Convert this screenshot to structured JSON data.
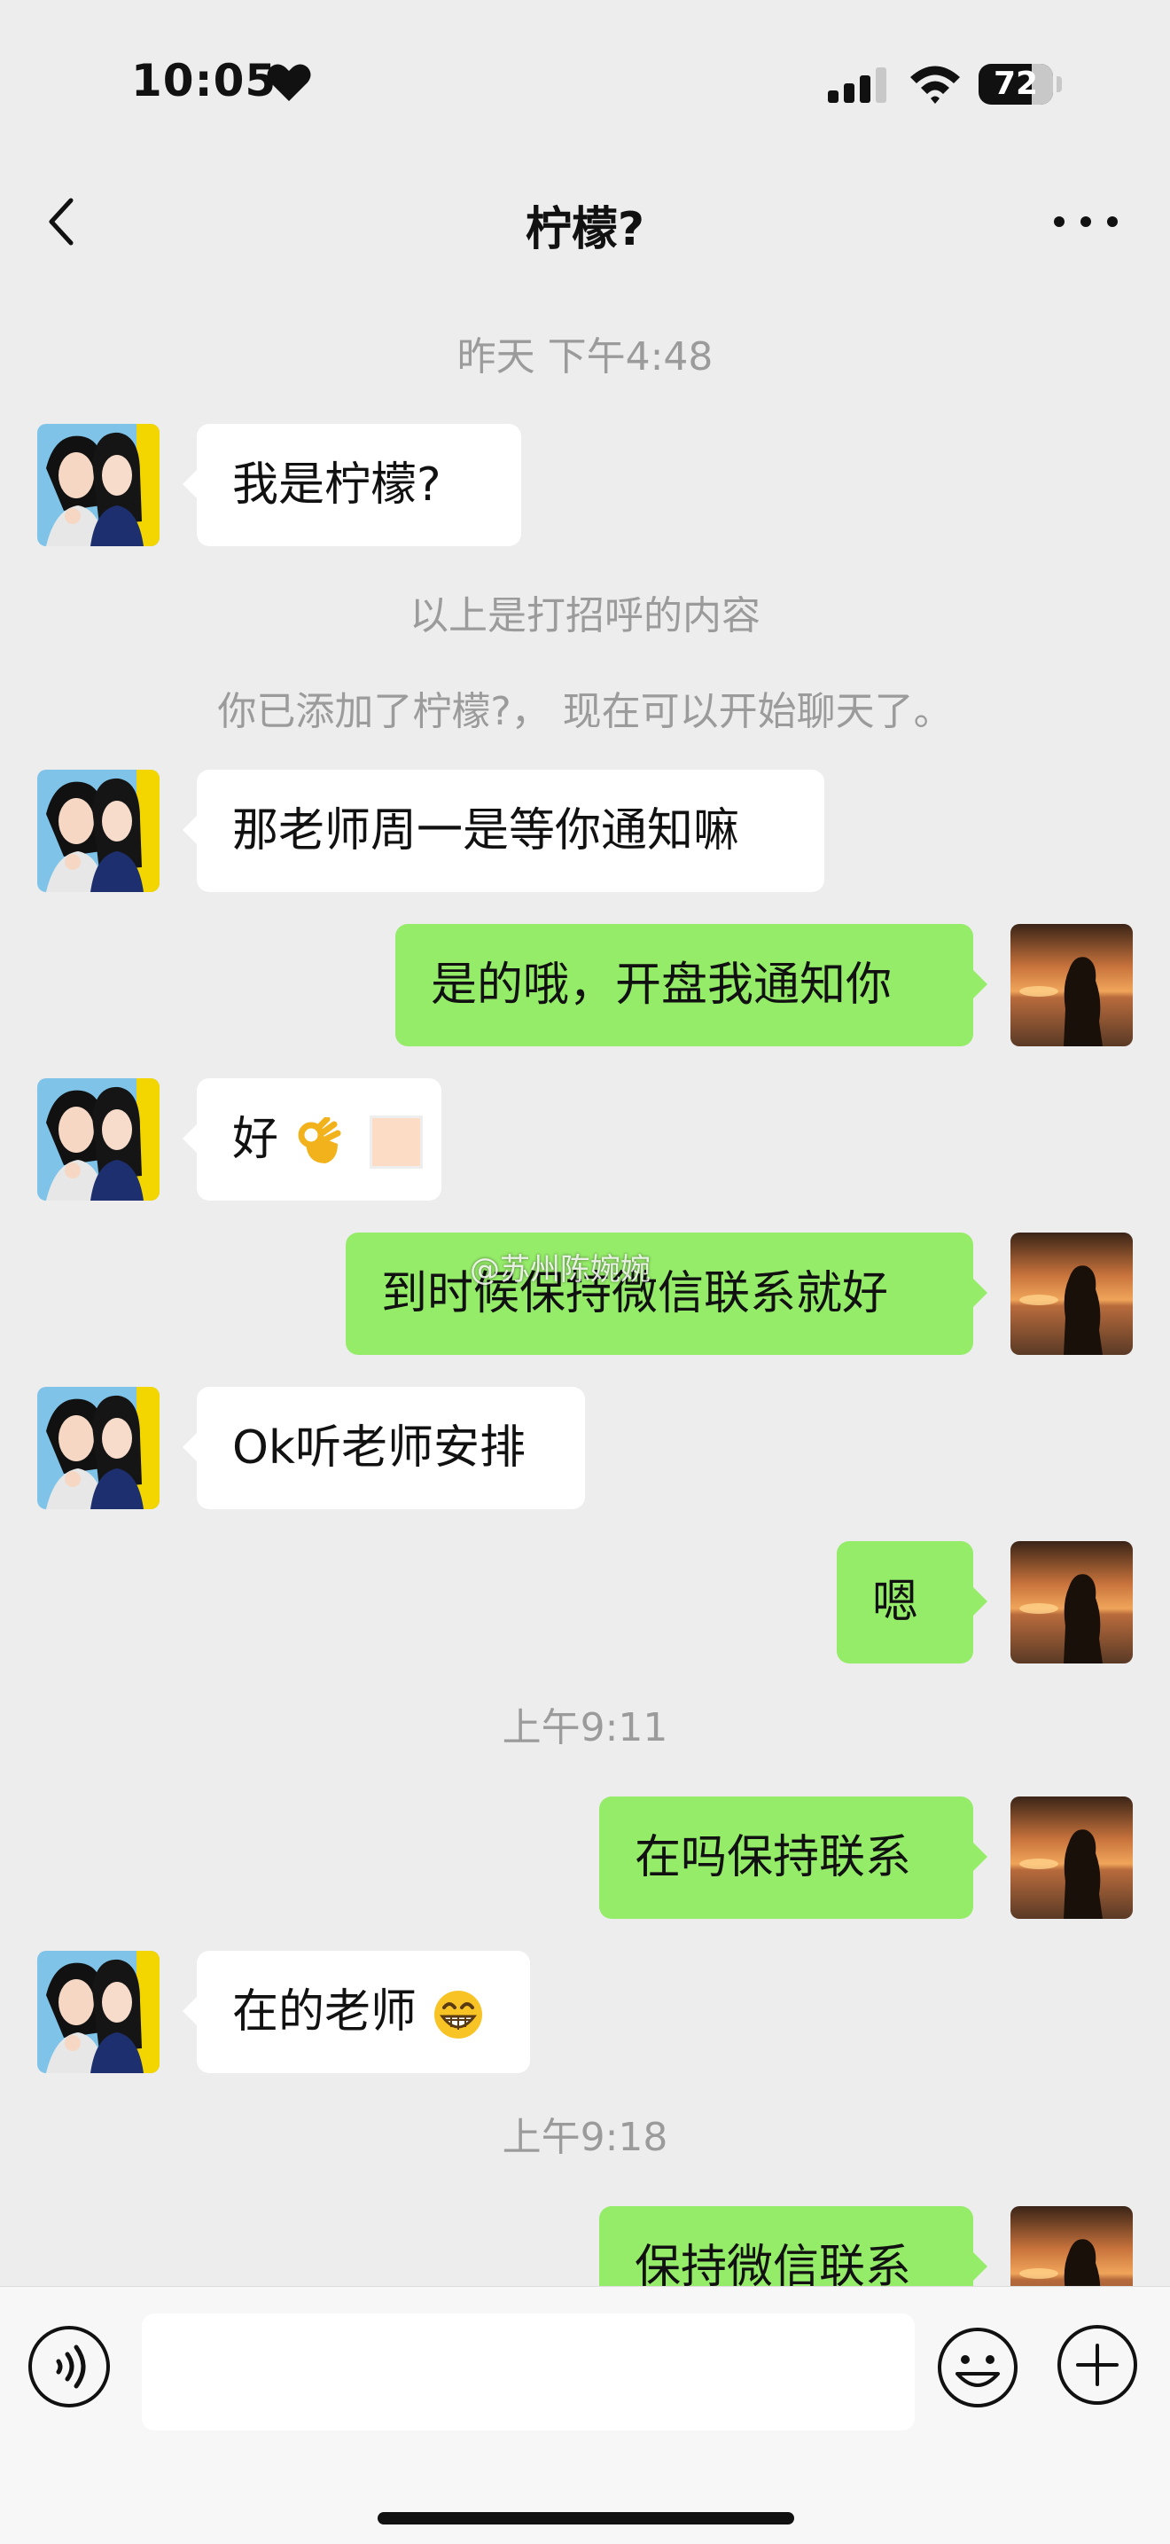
{
  "status_bar": {
    "time": "10:05",
    "battery": "72",
    "battery_level": 0.72
  },
  "nav": {
    "title": "柠檬?"
  },
  "timestamps": {
    "t1": "昨天 下午4:48",
    "t2": "上午9:11",
    "t3": "上午9:18"
  },
  "system_notes": {
    "greeting": "以上是打招呼的内容",
    "added": "你已添加了柠檬?， 现在可以开始聊天了。"
  },
  "messages": [
    {
      "from": "contact",
      "text": "我是柠檬?"
    },
    {
      "from": "contact",
      "text": "那老师周一是等你通知嘛"
    },
    {
      "from": "me",
      "text": "是的哦，开盘我通知你"
    },
    {
      "from": "contact",
      "text": "好"
    },
    {
      "from": "me",
      "text": "到时候保持微信联系就好"
    },
    {
      "from": "contact",
      "text": "Ok听老师安排"
    },
    {
      "from": "me",
      "text": "嗯"
    },
    {
      "from": "me",
      "text": "在吗保持联系"
    },
    {
      "from": "contact",
      "text": "在的老师"
    },
    {
      "from": "me",
      "text": "保持微信联系"
    }
  ],
  "watermark": "@苏州陈婉婉",
  "input": {
    "value": "",
    "placeholder": ""
  },
  "icons": {
    "back": "chevron-left-icon",
    "more": "more-dots-icon",
    "voice": "voice-icon",
    "emoji": "emoji-icon",
    "add": "plus-circle-icon"
  },
  "colors": {
    "background": "#ededed",
    "incoming_bubble": "#ffffff",
    "outgoing_bubble": "#95ec69",
    "meta_text": "#9b9b9b"
  }
}
